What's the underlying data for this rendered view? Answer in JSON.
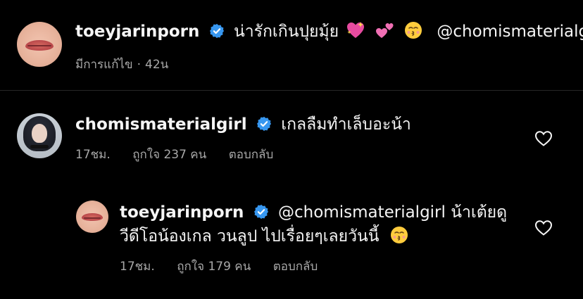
{
  "caption": {
    "username": "toeyjarinporn",
    "text": "น่ารักเกินปุยมุ้ย",
    "mention": "@chomismaterialgirl",
    "edited_label": "มีการแก้ไข",
    "separator": "·",
    "time": "42น"
  },
  "comments": [
    {
      "username": "chomismaterialgirl",
      "text": "เกลลืมทำเล็บอะน้า",
      "time": "17ชม.",
      "likes": "ถูกใจ 237 คน",
      "reply_label": "ตอบกลับ"
    },
    {
      "username": "toeyjarinporn",
      "mention": "@chomismaterialgirl",
      "text_line1": "น้าเต้ยดู",
      "text_line2": "วีดีโอน้องเกล วนลูป ไปเรื่อยๆเลยวันนี้",
      "time": "17ชม.",
      "likes": "ถูกใจ 179 คน",
      "reply_label": "ตอบกลับ"
    }
  ],
  "colors": {
    "verified": "#3797f0",
    "meta": "#a8a8a8",
    "background": "#000000"
  },
  "icons": [
    "verified-badge-icon",
    "heart-icon",
    "sparkling-heart-emoji",
    "two-hearts-emoji",
    "kissing-face-emoji"
  ]
}
